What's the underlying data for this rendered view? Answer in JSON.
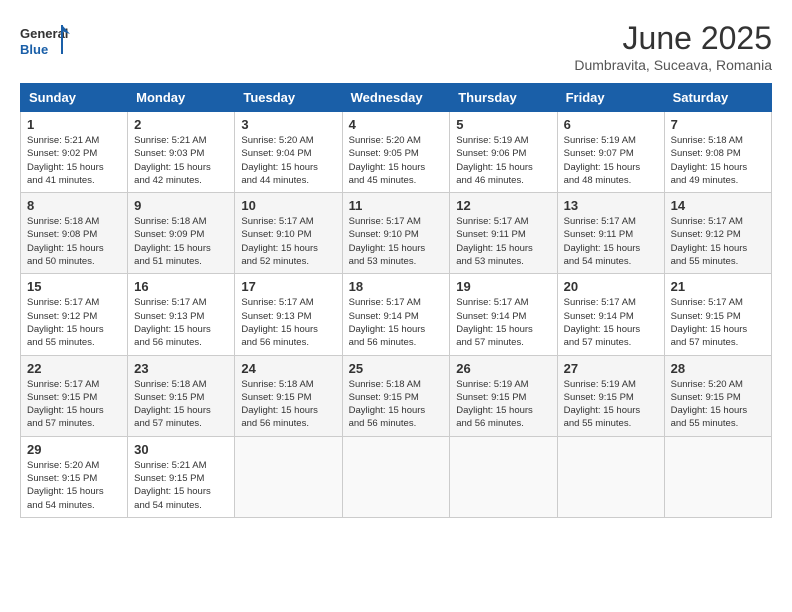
{
  "header": {
    "logo_line1": "General",
    "logo_line2": "Blue",
    "month_title": "June 2025",
    "location": "Dumbravita, Suceava, Romania"
  },
  "days_of_week": [
    "Sunday",
    "Monday",
    "Tuesday",
    "Wednesday",
    "Thursday",
    "Friday",
    "Saturday"
  ],
  "weeks": [
    [
      {
        "day": "1",
        "info": "Sunrise: 5:21 AM\nSunset: 9:02 PM\nDaylight: 15 hours\nand 41 minutes."
      },
      {
        "day": "2",
        "info": "Sunrise: 5:21 AM\nSunset: 9:03 PM\nDaylight: 15 hours\nand 42 minutes."
      },
      {
        "day": "3",
        "info": "Sunrise: 5:20 AM\nSunset: 9:04 PM\nDaylight: 15 hours\nand 44 minutes."
      },
      {
        "day": "4",
        "info": "Sunrise: 5:20 AM\nSunset: 9:05 PM\nDaylight: 15 hours\nand 45 minutes."
      },
      {
        "day": "5",
        "info": "Sunrise: 5:19 AM\nSunset: 9:06 PM\nDaylight: 15 hours\nand 46 minutes."
      },
      {
        "day": "6",
        "info": "Sunrise: 5:19 AM\nSunset: 9:07 PM\nDaylight: 15 hours\nand 48 minutes."
      },
      {
        "day": "7",
        "info": "Sunrise: 5:18 AM\nSunset: 9:08 PM\nDaylight: 15 hours\nand 49 minutes."
      }
    ],
    [
      {
        "day": "8",
        "info": "Sunrise: 5:18 AM\nSunset: 9:08 PM\nDaylight: 15 hours\nand 50 minutes."
      },
      {
        "day": "9",
        "info": "Sunrise: 5:18 AM\nSunset: 9:09 PM\nDaylight: 15 hours\nand 51 minutes."
      },
      {
        "day": "10",
        "info": "Sunrise: 5:17 AM\nSunset: 9:10 PM\nDaylight: 15 hours\nand 52 minutes."
      },
      {
        "day": "11",
        "info": "Sunrise: 5:17 AM\nSunset: 9:10 PM\nDaylight: 15 hours\nand 53 minutes."
      },
      {
        "day": "12",
        "info": "Sunrise: 5:17 AM\nSunset: 9:11 PM\nDaylight: 15 hours\nand 53 minutes."
      },
      {
        "day": "13",
        "info": "Sunrise: 5:17 AM\nSunset: 9:11 PM\nDaylight: 15 hours\nand 54 minutes."
      },
      {
        "day": "14",
        "info": "Sunrise: 5:17 AM\nSunset: 9:12 PM\nDaylight: 15 hours\nand 55 minutes."
      }
    ],
    [
      {
        "day": "15",
        "info": "Sunrise: 5:17 AM\nSunset: 9:12 PM\nDaylight: 15 hours\nand 55 minutes."
      },
      {
        "day": "16",
        "info": "Sunrise: 5:17 AM\nSunset: 9:13 PM\nDaylight: 15 hours\nand 56 minutes."
      },
      {
        "day": "17",
        "info": "Sunrise: 5:17 AM\nSunset: 9:13 PM\nDaylight: 15 hours\nand 56 minutes."
      },
      {
        "day": "18",
        "info": "Sunrise: 5:17 AM\nSunset: 9:14 PM\nDaylight: 15 hours\nand 56 minutes."
      },
      {
        "day": "19",
        "info": "Sunrise: 5:17 AM\nSunset: 9:14 PM\nDaylight: 15 hours\nand 57 minutes."
      },
      {
        "day": "20",
        "info": "Sunrise: 5:17 AM\nSunset: 9:14 PM\nDaylight: 15 hours\nand 57 minutes."
      },
      {
        "day": "21",
        "info": "Sunrise: 5:17 AM\nSunset: 9:15 PM\nDaylight: 15 hours\nand 57 minutes."
      }
    ],
    [
      {
        "day": "22",
        "info": "Sunrise: 5:17 AM\nSunset: 9:15 PM\nDaylight: 15 hours\nand 57 minutes."
      },
      {
        "day": "23",
        "info": "Sunrise: 5:18 AM\nSunset: 9:15 PM\nDaylight: 15 hours\nand 57 minutes."
      },
      {
        "day": "24",
        "info": "Sunrise: 5:18 AM\nSunset: 9:15 PM\nDaylight: 15 hours\nand 56 minutes."
      },
      {
        "day": "25",
        "info": "Sunrise: 5:18 AM\nSunset: 9:15 PM\nDaylight: 15 hours\nand 56 minutes."
      },
      {
        "day": "26",
        "info": "Sunrise: 5:19 AM\nSunset: 9:15 PM\nDaylight: 15 hours\nand 56 minutes."
      },
      {
        "day": "27",
        "info": "Sunrise: 5:19 AM\nSunset: 9:15 PM\nDaylight: 15 hours\nand 55 minutes."
      },
      {
        "day": "28",
        "info": "Sunrise: 5:20 AM\nSunset: 9:15 PM\nDaylight: 15 hours\nand 55 minutes."
      }
    ],
    [
      {
        "day": "29",
        "info": "Sunrise: 5:20 AM\nSunset: 9:15 PM\nDaylight: 15 hours\nand 54 minutes."
      },
      {
        "day": "30",
        "info": "Sunrise: 5:21 AM\nSunset: 9:15 PM\nDaylight: 15 hours\nand 54 minutes."
      },
      {
        "day": "",
        "info": ""
      },
      {
        "day": "",
        "info": ""
      },
      {
        "day": "",
        "info": ""
      },
      {
        "day": "",
        "info": ""
      },
      {
        "day": "",
        "info": ""
      }
    ]
  ]
}
